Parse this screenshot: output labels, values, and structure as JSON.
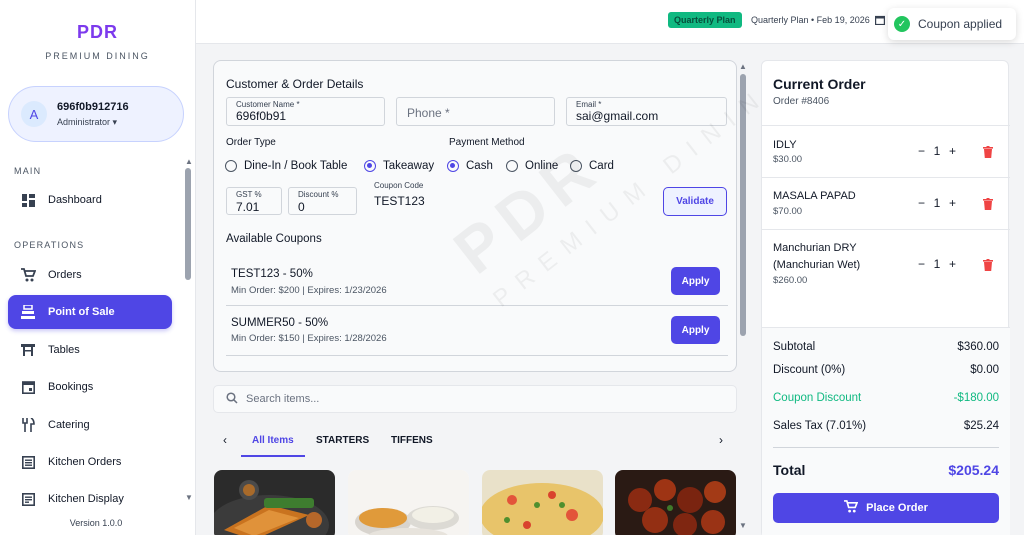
{
  "brand": {
    "logo": "PDR",
    "subtitle": "PREMIUM DINING"
  },
  "user": {
    "avatar_initial": "A",
    "name": "696f0b912716",
    "role": "Administrator ▾"
  },
  "sidebar": {
    "main_label": "MAIN",
    "operations_label": "OPERATIONS",
    "items": [
      {
        "label": "Dashboard",
        "icon": "dashboard-icon"
      },
      {
        "label": "Orders",
        "icon": "cart-icon"
      },
      {
        "label": "Point of Sale",
        "icon": "pos-icon",
        "active": true
      },
      {
        "label": "Tables",
        "icon": "table-icon"
      },
      {
        "label": "Bookings",
        "icon": "calendar-icon"
      },
      {
        "label": "Catering",
        "icon": "utensils-icon"
      },
      {
        "label": "Kitchen Orders",
        "icon": "list-icon"
      },
      {
        "label": "Kitchen Display",
        "icon": "display-icon"
      }
    ],
    "version": "Version 1.0.0"
  },
  "topbar": {
    "plan_badge": "Quarterly Plan",
    "plan_text": "Quarterly Plan • Feb 19, 2026",
    "toast": "Coupon applied"
  },
  "form": {
    "title": "Customer & Order Details",
    "customer_name_label": "Customer Name *",
    "customer_name": "696f0b91",
    "phone_placeholder": "Phone *",
    "email_label": "Email *",
    "email": "sai@gmail.com",
    "order_type_label": "Order Type",
    "order_types": [
      "Dine-In / Book Table",
      "Takeaway"
    ],
    "payment_label": "Payment Method",
    "payment_methods": [
      "Cash",
      "Online",
      "Card"
    ],
    "gst_label": "GST %",
    "gst": "7.01",
    "discount_label": "Discount %",
    "discount": "0",
    "coupon_label": "Coupon Code",
    "coupon": "TEST123",
    "validate": "Validate",
    "available_coupons_label": "Available Coupons",
    "coupons": [
      {
        "name": "TEST123 - 50%",
        "meta": "Min Order: $200 | Expires: 1/23/2026",
        "action": "Apply"
      },
      {
        "name": "SUMMER50 - 50%",
        "meta": "Min Order: $150 | Expires: 1/28/2026",
        "action": "Apply"
      }
    ]
  },
  "watermark": {
    "line1": "PDR",
    "line2": "PREMIUM DINING"
  },
  "search": {
    "placeholder": "Search items..."
  },
  "tabs": [
    "All Items",
    "STARTERS",
    "TIFFENS"
  ],
  "order": {
    "title": "Current Order",
    "number": "Order #8406",
    "items": [
      {
        "name": "IDLY",
        "price": "$30.00",
        "qty": "1"
      },
      {
        "name": "MASALA PAPAD",
        "price": "$70.00",
        "qty": "1"
      },
      {
        "name": "Manchurian DRY (Manchurian Wet)",
        "price": "$260.00",
        "qty": "1"
      }
    ],
    "subtotal_label": "Subtotal",
    "subtotal": "$360.00",
    "discount_label": "Discount (0%)",
    "discount": "$0.00",
    "coupon_label": "Coupon Discount",
    "coupon": "-$180.00",
    "tax_label": "Sales Tax (7.01%)",
    "tax": "$25.24",
    "total_label": "Total",
    "total": "$205.24",
    "place_order": "Place Order"
  },
  "colors": {
    "accent": "#4f46e5",
    "brand": "#7c3aed",
    "success": "#10b981",
    "danger": "#ef4444"
  }
}
